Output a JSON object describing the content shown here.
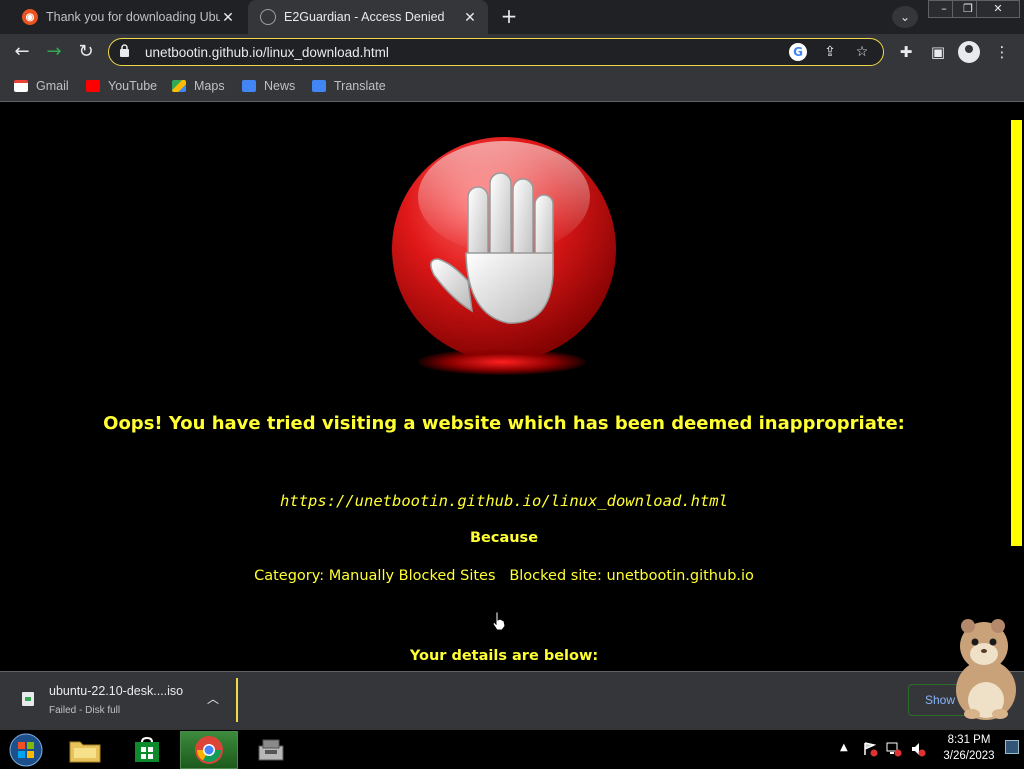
{
  "tabs": [
    {
      "title": "Thank you for downloading Ubun",
      "favicon": "ubuntu-icon",
      "active": false
    },
    {
      "title": "E2Guardian - Access Denied",
      "favicon": "globe-icon",
      "active": true
    }
  ],
  "window_controls": {
    "minimize": "–",
    "restore": "❐",
    "close": "✕"
  },
  "toolbar": {
    "url": "unetbootin.github.io/linux_download.html"
  },
  "bookmarks": [
    {
      "label": "Gmail",
      "icon": "gmail-icon"
    },
    {
      "label": "YouTube",
      "icon": "youtube-icon"
    },
    {
      "label": "Maps",
      "icon": "maps-icon"
    },
    {
      "label": "News",
      "icon": "news-icon"
    },
    {
      "label": "Translate",
      "icon": "translate-icon"
    }
  ],
  "page": {
    "headline": "Oops! You have tried visiting a website which has been deemed inappropriate:",
    "blocked_url": "https://unetbootin.github.io/linux_download.html",
    "because_label": "Because",
    "category_line": "Category: Manually Blocked Sites   Blocked site: unetbootin.github.io",
    "details_heading": "Your details are below:",
    "text_color": "#ffff33"
  },
  "downloads": {
    "file_name": "ubuntu-22.10-desk....iso",
    "status": "Failed - Disk full",
    "show_all_label": "Show all"
  },
  "taskbar": {
    "time": "8:31 PM",
    "date": "3/26/2023"
  },
  "colors": {
    "omnibox_border": "#f2d84a",
    "scroll_thumb": "#ffff00",
    "chrome_dark": "#35363a"
  }
}
